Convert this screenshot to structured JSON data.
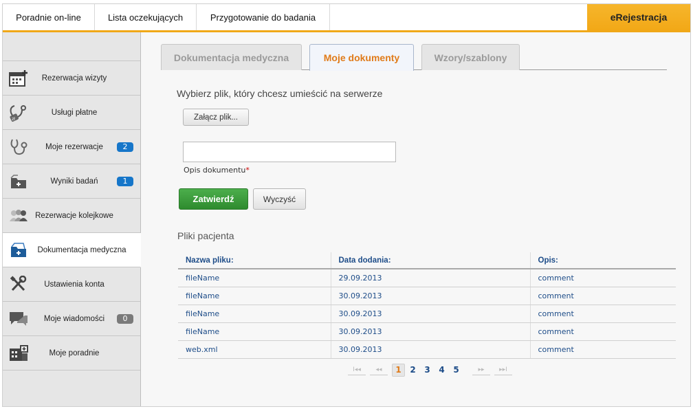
{
  "topnav": {
    "items": [
      "Poradnie on-line",
      "Lista oczekujących",
      "Przygotowanie do badania"
    ],
    "brand": "eRejestracja"
  },
  "sidebar": {
    "items": [
      {
        "label": "Rezerwacja wizyty",
        "icon": "calendar-add-icon"
      },
      {
        "label": "Usługi płatne",
        "icon": "paid-services-icon"
      },
      {
        "label": "Moje rezerwacje",
        "icon": "stethoscope-icon",
        "badge": "2"
      },
      {
        "label": "Wyniki badań",
        "icon": "results-folder-icon",
        "badge": "1"
      },
      {
        "label": "Rezerwacje kolejkowe",
        "icon": "people-queue-icon"
      },
      {
        "label": "Dokumentacja medyczna",
        "icon": "medical-folder-icon",
        "active": true
      },
      {
        "label": "Ustawienia konta",
        "icon": "tools-icon"
      },
      {
        "label": "Moje wiadomości",
        "icon": "chat-icon",
        "badge": "0"
      },
      {
        "label": "Moje poradnie",
        "icon": "building-icon"
      }
    ]
  },
  "tabs": [
    "Dokumentacja medyczna",
    "Moje dokumenty",
    "Wzory/szablony"
  ],
  "upload": {
    "heading": "Wybierz plik, który chcesz umieścić na serwerze",
    "attach_label": "Załącz plik...",
    "desc_value": "",
    "desc_label": "Opis dokumentu",
    "required_mark": "*",
    "submit_label": "Zatwierdź",
    "clear_label": "Wyczyść"
  },
  "files": {
    "heading": "Pliki pacjenta",
    "columns": [
      "Nazwa pliku:",
      "Data dodania:",
      "Opis:"
    ],
    "rows": [
      [
        "fileName",
        "29.09.2013",
        "comment"
      ],
      [
        "fileName",
        "30.09.2013",
        "comment"
      ],
      [
        "fileName",
        "30.09.2013",
        "comment"
      ],
      [
        "fileName",
        "30.09.2013",
        "comment"
      ],
      [
        "web.xml",
        "30.09.2013",
        "comment"
      ]
    ]
  },
  "pager": {
    "first": "I◂◂",
    "prev": "◂◂",
    "next": "▸▸",
    "last": "▸▸I",
    "pages": [
      "1",
      "2",
      "3",
      "4",
      "5"
    ],
    "current": "1"
  },
  "colors": {
    "accent": "#f0a818",
    "active_tab": "#e07b1a",
    "link": "#1d4c88",
    "submit": "#3a9a3a",
    "badge_blue": "#1676c9"
  }
}
